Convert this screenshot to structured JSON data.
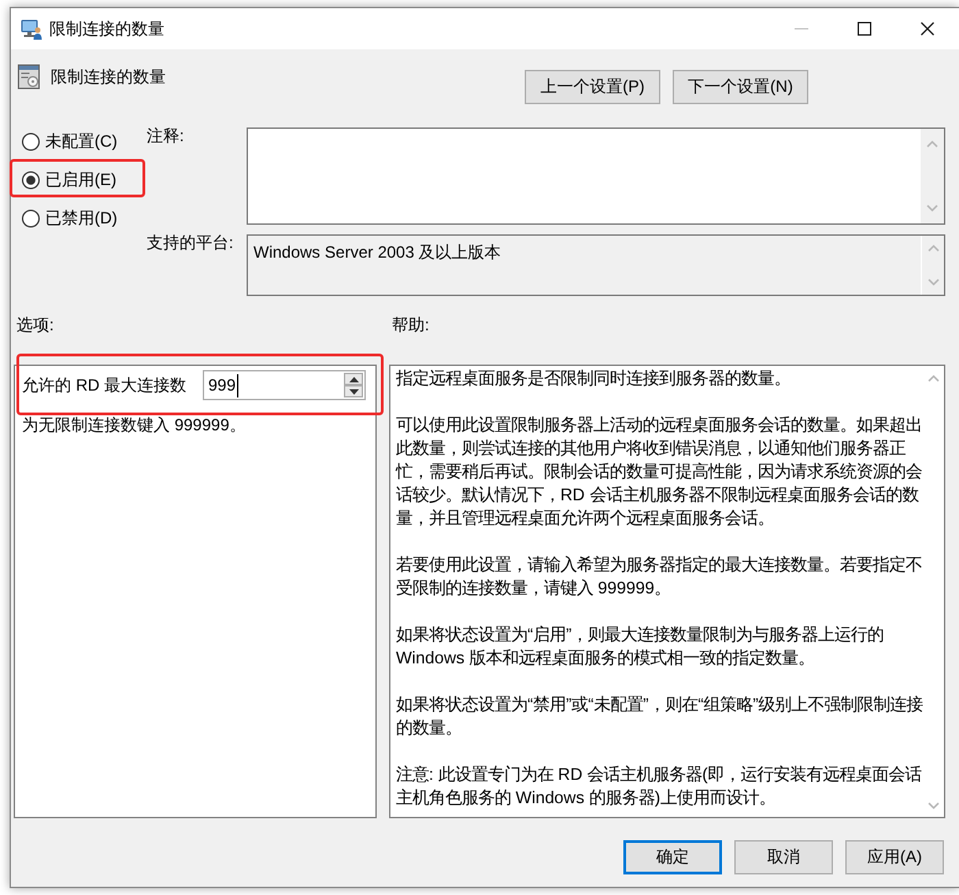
{
  "window": {
    "title": "限制连接的数量",
    "buttons": [
      {
        "kind": "minimize",
        "disabled": true
      },
      {
        "kind": "maximize",
        "disabled": false
      },
      {
        "kind": "close",
        "disabled": false
      }
    ]
  },
  "setting": {
    "title": "限制连接的数量"
  },
  "nav_buttons": [
    {
      "label": "上一个设置(P)"
    },
    {
      "label": "下一个设置(N)"
    }
  ],
  "state_options": [
    {
      "label": "未配置(C)",
      "selected": false,
      "highlighted": false
    },
    {
      "label": "已启用(E)",
      "selected": true,
      "highlighted": true
    },
    {
      "label": "已禁用(D)",
      "selected": false,
      "highlighted": false
    }
  ],
  "comment": {
    "label": "注释:"
  },
  "supported_platforms": {
    "label": "支持的平台:",
    "value": "Windows Server 2003 及以上版本"
  },
  "options": {
    "label": "选项:",
    "items": [
      {
        "kind": "spinner",
        "label": "允许的 RD 最大连接数",
        "value": "999",
        "highlighted": true
      }
    ],
    "note": "为无限制连接数键入 999999。"
  },
  "help": {
    "label": "帮助:",
    "paragraphs": [
      "指定远程桌面服务是否限制同时连接到服务器的数量。",
      "可以使用此设置限制服务器上活动的远程桌面服务会话的数量。如果超出此数量，则尝试连接的其他用户将收到错误消息，以通知他们服务器正忙，需要稍后再试。限制会话的数量可提高性能，因为请求系统资源的会话较少。默认情况下，RD 会话主机服务器不限制远程桌面服务会话的数量，并且管理远程桌面允许两个远程桌面服务会话。",
      "若要使用此设置，请输入希望为服务器指定的最大连接数量。若要指定不受限制的连接数量，请键入 999999。",
      "如果将状态设置为“启用”，则最大连接数量限制为与服务器上运行的 Windows 版本和远程桌面服务的模式相一致的指定数量。",
      "如果将状态设置为“禁用”或“未配置”，则在“组策略”级别上不强制限制连接的数量。",
      "注意: 此设置专门为在 RD 会话主机服务器(即，运行安装有远程桌面会话主机角色服务的 Windows 的服务器)上使用而设计。"
    ]
  },
  "buttons": [
    {
      "label": "确定",
      "default": true
    },
    {
      "label": "取消",
      "default": false
    },
    {
      "label": "应用(A)",
      "default": false
    }
  ]
}
